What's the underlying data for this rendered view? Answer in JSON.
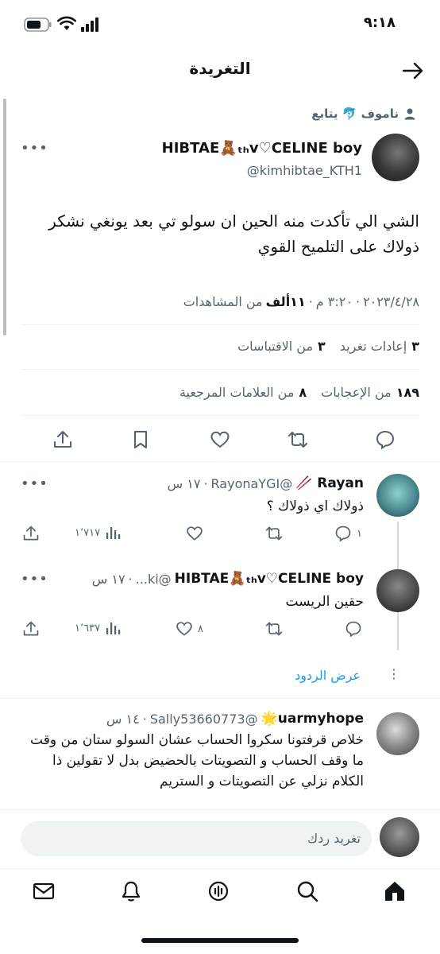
{
  "status_bar": {
    "time": "٩:١٨"
  },
  "header": {
    "title": "التغريدة"
  },
  "social_context": {
    "text": "ناموف 🐬 يتابع"
  },
  "tweet": {
    "display_name": "HIBTAE🧸ₜₕv♡CELINE boy",
    "handle": "@kimhibtae_KTH1",
    "text": "الشي الي تأكدت منه الحين ان سولو تي بعد يونغي نشكر ذولاك على التلميح القوي",
    "meta_time": "٣:٢٠ م",
    "meta_date": "٢٠٢٣/٤/٢٨",
    "meta_views_count": "١١ألف",
    "meta_views_label": "من المشاهدات",
    "retweets_count": "٣",
    "retweets_label": "إعادات تغريد",
    "quotes_count": "٣",
    "quotes_label": "من الاقتباسات",
    "likes_count": "١٨٩",
    "likes_label": "من الإعجابات",
    "bookmarks_count": "٨",
    "bookmarks_label": "من العلامات المرجعية"
  },
  "replies": [
    {
      "name": "Rayan 🥢",
      "handle": "@RayonaYGI",
      "time": "١٧ س",
      "text": "ذولاك اي ذولاك ؟",
      "replies": "١",
      "retweets": "",
      "likes": "",
      "views": "١٬٧١٧"
    },
    {
      "name": "HIBTAE🧸ₜₕv♡CELINE boy",
      "handle": "@ki...",
      "time": "١٧ س",
      "text": "حقين الريست",
      "replies": "",
      "retweets": "",
      "likes": "٨",
      "views": "١٬٦٣٧"
    },
    {
      "name": "uarmyhope🌟",
      "handle": "@Sally53660773",
      "time": "١٤ س",
      "text": "خلاص قرفتونا سكروا الحساب عشان السولو ستان من وقت ما وقف الحساب و التصويتات بالحضيض بدل لا تقولين ذا الكلام نزلي عن التصويتات و الستريم",
      "replies": "",
      "retweets": "",
      "likes": "",
      "views": ""
    }
  ],
  "show_replies": "عرض الردود",
  "composer": {
    "placeholder": "تغريد ردك"
  },
  "colors": {
    "accent": "#1d9bf0",
    "text": "#0f1419",
    "muted": "#536471",
    "divider": "#eff3f4"
  },
  "nav": [
    "mail-icon",
    "spaces-icon",
    "notifications-icon",
    "search-icon",
    "home-icon"
  ]
}
